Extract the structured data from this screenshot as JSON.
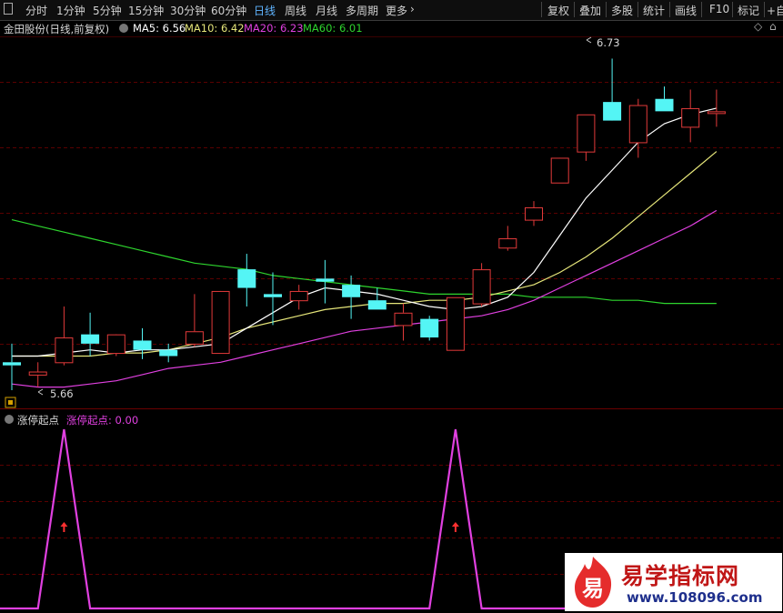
{
  "toolbar": {
    "periods": [
      "分时",
      "1分钟",
      "5分钟",
      "15分钟",
      "30分钟",
      "60分钟",
      "日线",
      "周线",
      "月线",
      "多周期",
      "更多"
    ],
    "active_period": "日线",
    "tools": [
      "复权",
      "叠加",
      "多股",
      "统计",
      "画线",
      "F10",
      "标记",
      "+自"
    ]
  },
  "chart_header": {
    "title": "金田股份(日线,前复权)",
    "ma5": "MA5: 6.56",
    "ma10": "MA10: 6.42",
    "ma20": "MA20: 6.23",
    "ma60": "MA60: 6.01"
  },
  "indicator_header": {
    "name": "涨停起点",
    "value": "涨停起点: 0.00"
  },
  "annotations": {
    "high": "6.73",
    "low": "5.66"
  },
  "watermark": {
    "logo_char": "易",
    "title": "易学指标网",
    "url": "www.108096.com"
  },
  "colors": {
    "up": "#e23a3a",
    "down": "#54f5f5",
    "ma5": "#ffffff",
    "ma10": "#e6e67a",
    "ma20": "#e040e0",
    "ma60": "#2ed52e",
    "indicator": "#e040e0",
    "arrow": "#ff3030",
    "grid": "#5a0000"
  },
  "chart_data": {
    "type": "candlestick",
    "candles": [
      {
        "o": 5.74,
        "h": 5.8,
        "l": 5.65,
        "c": 5.73
      },
      {
        "o": 5.7,
        "h": 5.74,
        "l": 5.66,
        "c": 5.71
      },
      {
        "o": 5.74,
        "h": 5.92,
        "l": 5.73,
        "c": 5.82
      },
      {
        "o": 5.83,
        "h": 5.9,
        "l": 5.76,
        "c": 5.8
      },
      {
        "o": 5.77,
        "h": 5.82,
        "l": 5.76,
        "c": 5.83
      },
      {
        "o": 5.81,
        "h": 5.85,
        "l": 5.75,
        "c": 5.78
      },
      {
        "o": 5.78,
        "h": 5.8,
        "l": 5.74,
        "c": 5.76
      },
      {
        "o": 5.8,
        "h": 5.96,
        "l": 5.79,
        "c": 5.84
      },
      {
        "o": 5.77,
        "h": 5.95,
        "l": 5.77,
        "c": 5.97
      },
      {
        "o": 6.04,
        "h": 6.09,
        "l": 5.92,
        "c": 5.98
      },
      {
        "o": 5.96,
        "h": 6.03,
        "l": 5.86,
        "c": 5.95
      },
      {
        "o": 5.94,
        "h": 5.99,
        "l": 5.91,
        "c": 5.97
      },
      {
        "o": 6.01,
        "h": 6.07,
        "l": 5.93,
        "c": 6.0
      },
      {
        "o": 5.99,
        "h": 6.02,
        "l": 5.88,
        "c": 5.95
      },
      {
        "o": 5.94,
        "h": 5.98,
        "l": 5.91,
        "c": 5.91
      },
      {
        "o": 5.86,
        "h": 5.93,
        "l": 5.81,
        "c": 5.9
      },
      {
        "o": 5.88,
        "h": 5.89,
        "l": 5.81,
        "c": 5.82
      },
      {
        "o": 5.78,
        "h": 5.95,
        "l": 5.78,
        "c": 5.95
      },
      {
        "o": 5.93,
        "h": 6.06,
        "l": 5.92,
        "c": 6.04
      },
      {
        "o": 6.11,
        "h": 6.18,
        "l": 6.1,
        "c": 6.14
      },
      {
        "o": 6.2,
        "h": 6.26,
        "l": 6.18,
        "c": 6.24
      },
      {
        "o": 6.32,
        "h": 6.38,
        "l": 6.32,
        "c": 6.4
      },
      {
        "o": 6.42,
        "h": 6.54,
        "l": 6.39,
        "c": 6.54
      },
      {
        "o": 6.58,
        "h": 6.72,
        "l": 6.58,
        "c": 6.52
      },
      {
        "o": 6.45,
        "h": 6.59,
        "l": 6.4,
        "c": 6.57
      },
      {
        "o": 6.59,
        "h": 6.63,
        "l": 6.55,
        "c": 6.55
      },
      {
        "o": 6.5,
        "h": 6.62,
        "l": 6.45,
        "c": 6.56
      },
      {
        "o": 6.55,
        "h": 6.62,
        "l": 6.5,
        "c": 6.55
      }
    ],
    "ma5": [
      5.76,
      5.76,
      5.77,
      5.78,
      5.77,
      5.78,
      5.78,
      5.79,
      5.8,
      5.85,
      5.9,
      5.95,
      5.98,
      5.97,
      5.96,
      5.94,
      5.92,
      5.91,
      5.92,
      5.95,
      6.03,
      6.15,
      6.27,
      6.36,
      6.45,
      6.51,
      6.54,
      6.56
    ],
    "ma10": [
      5.76,
      5.76,
      5.76,
      5.76,
      5.77,
      5.77,
      5.78,
      5.8,
      5.82,
      5.85,
      5.87,
      5.89,
      5.91,
      5.92,
      5.93,
      5.93,
      5.94,
      5.94,
      5.95,
      5.97,
      5.99,
      6.03,
      6.08,
      6.14,
      6.21,
      6.28,
      6.35,
      6.42
    ],
    "ma20": [
      5.67,
      5.66,
      5.66,
      5.67,
      5.68,
      5.7,
      5.72,
      5.73,
      5.74,
      5.76,
      5.78,
      5.8,
      5.82,
      5.84,
      5.85,
      5.86,
      5.87,
      5.88,
      5.89,
      5.91,
      5.94,
      5.98,
      6.02,
      6.06,
      6.1,
      6.14,
      6.18,
      6.23
    ],
    "ma60": [
      6.2,
      6.18,
      6.16,
      6.14,
      6.12,
      6.1,
      6.08,
      6.06,
      6.05,
      6.04,
      6.02,
      6.01,
      6.0,
      5.99,
      5.98,
      5.97,
      5.96,
      5.96,
      5.96,
      5.96,
      5.95,
      5.95,
      5.95,
      5.94,
      5.94,
      5.93,
      5.93,
      5.93
    ],
    "ylim": [
      5.6,
      6.78
    ],
    "indicator": {
      "name": "涨停起点",
      "values": [
        0,
        0,
        1,
        0,
        0,
        0,
        0,
        0,
        0,
        0,
        0,
        0,
        0,
        0,
        0,
        0,
        0,
        1,
        0,
        0,
        0,
        0,
        0,
        0,
        0,
        0,
        0,
        0
      ],
      "ylim": [
        0,
        1
      ]
    }
  }
}
